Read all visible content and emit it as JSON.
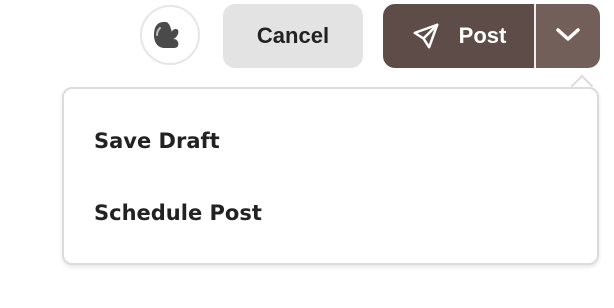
{
  "toolbar": {
    "cancel_label": "Cancel",
    "post_label": "Post",
    "post_icon": "send-icon",
    "menu_icon": "chevron-down-icon",
    "avatar_icon": "avatar"
  },
  "dropdown": {
    "items": [
      {
        "label": "Save Draft"
      },
      {
        "label": "Schedule Post"
      }
    ]
  },
  "colors": {
    "post_primary": "#5d4c48",
    "post_menu": "#735f5a",
    "cancel_bg": "#e3e3e3",
    "text_dark": "#222222"
  }
}
